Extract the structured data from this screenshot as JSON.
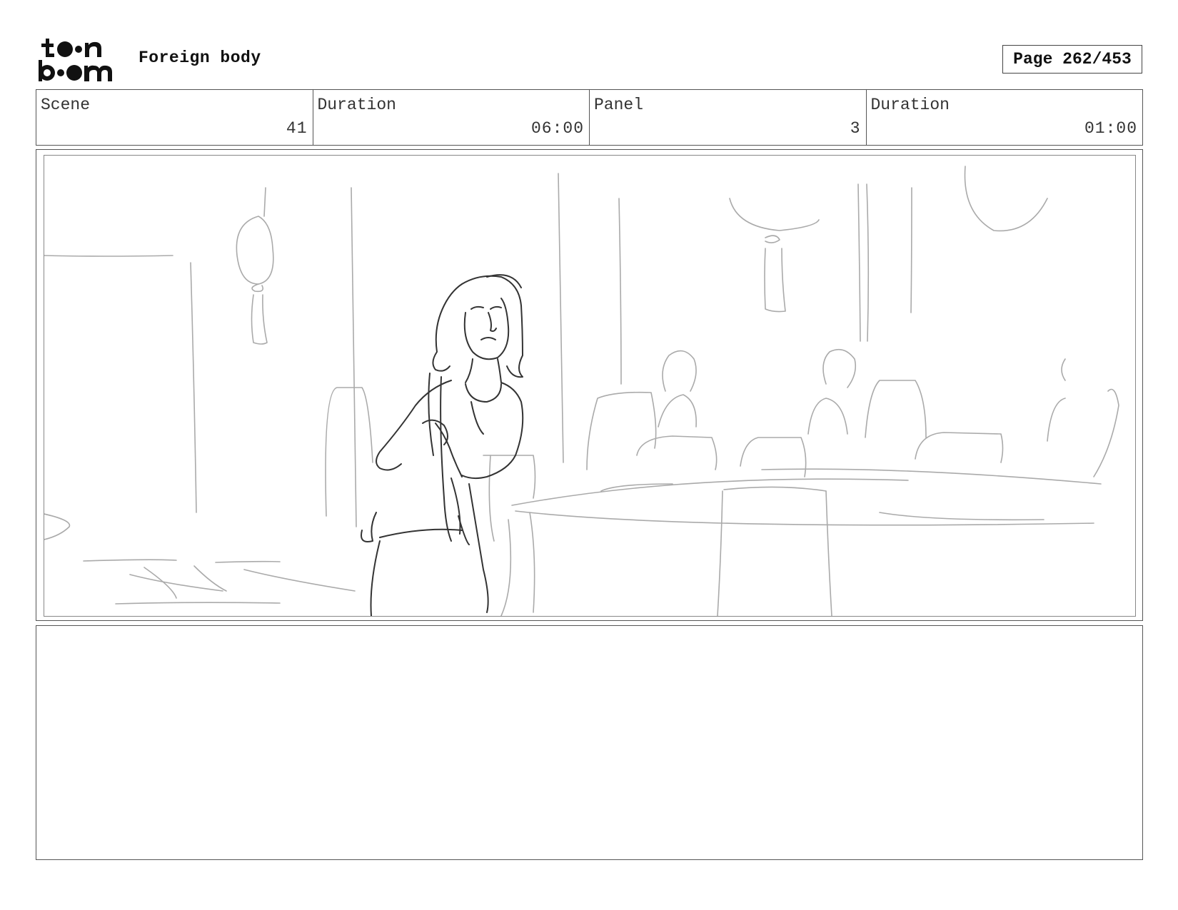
{
  "header": {
    "logo_text": "toonboom",
    "project_title": "Foreign body",
    "page_label": "Page 262/453"
  },
  "info": {
    "scene_label": "Scene",
    "scene_value": "41",
    "scene_duration_label": "Duration",
    "scene_duration_value": "06:00",
    "panel_label": "Panel",
    "panel_value": "3",
    "panel_duration_label": "Duration",
    "panel_duration_value": "01:00"
  },
  "panel": {
    "description": ""
  },
  "notes": {
    "text": ""
  }
}
